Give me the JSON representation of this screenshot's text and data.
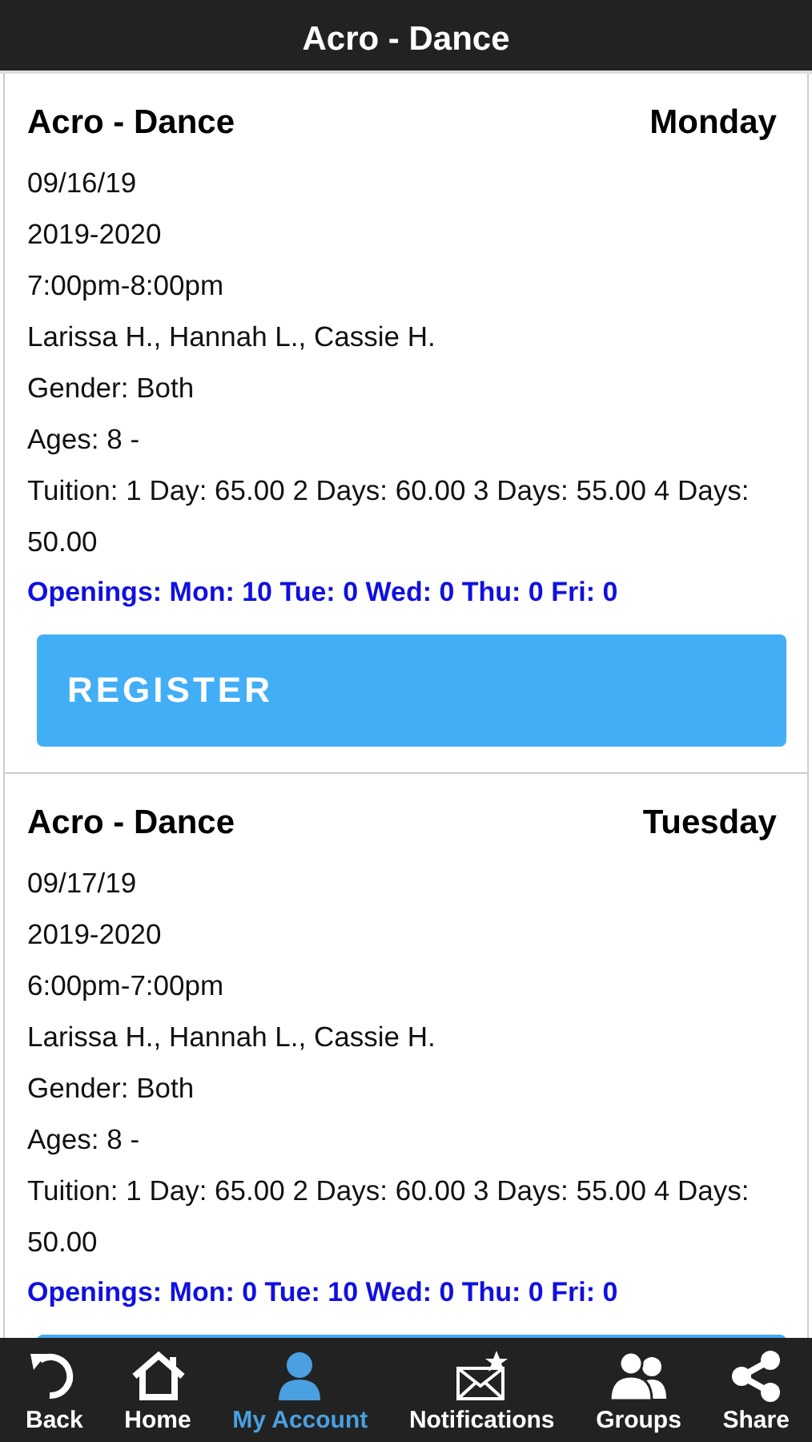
{
  "header": {
    "title": "Acro - Dance"
  },
  "classes": [
    {
      "name": "Acro - Dance",
      "day": "Monday",
      "lines": [
        "09/16/19",
        "2019-2020",
        "7:00pm-8:00pm",
        "Larissa H., Hannah L., Cassie H.",
        "Gender: Both",
        "Ages: 8 -",
        "Tuition: 1 Day: 65.00 2 Days: 60.00 3 Days: 55.00 4 Days: 50.00"
      ],
      "openings": "Openings: Mon: 10 Tue: 0 Wed: 0 Thu: 0 Fri: 0",
      "button": "REGISTER"
    },
    {
      "name": "Acro - Dance",
      "day": "Tuesday",
      "lines": [
        "09/17/19",
        "2019-2020",
        "6:00pm-7:00pm",
        "Larissa H., Hannah L., Cassie H.",
        "Gender: Both",
        "Ages: 8 -",
        "Tuition: 1 Day: 65.00 2 Days: 60.00 3 Days: 55.00 4 Days: 50.00"
      ],
      "openings": "Openings: Mon: 0 Tue: 10 Wed: 0 Thu: 0 Fri: 0"
    }
  ],
  "nav": [
    {
      "kind": "back",
      "label": "Back",
      "selected": false
    },
    {
      "kind": "home",
      "label": "Home",
      "selected": false
    },
    {
      "kind": "account",
      "label": "My Account",
      "selected": true
    },
    {
      "kind": "notifications",
      "label": "Notifications",
      "selected": false
    },
    {
      "kind": "groups",
      "label": "Groups",
      "selected": false
    },
    {
      "kind": "share",
      "label": "Share",
      "selected": false
    }
  ]
}
